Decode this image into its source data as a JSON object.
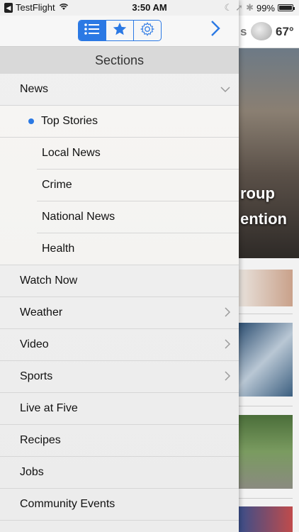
{
  "status_bar": {
    "back_app": "TestFlight",
    "time": "3:50 AM",
    "battery": "99%"
  },
  "toolbar": {
    "segments": [
      {
        "name": "sections",
        "icon": "list-icon",
        "active": true
      },
      {
        "name": "favorites",
        "icon": "star-icon",
        "active": false
      },
      {
        "name": "settings",
        "icon": "gear-icon",
        "active": false
      }
    ],
    "next_icon": "chevron-right-icon"
  },
  "drawer": {
    "title": "Sections",
    "items": [
      {
        "label": "News",
        "type": "top",
        "chevron": "down"
      },
      {
        "label": "Top Stories",
        "type": "sub",
        "selected": true
      },
      {
        "label": "Local News",
        "type": "sub"
      },
      {
        "label": "Crime",
        "type": "sub"
      },
      {
        "label": "National News",
        "type": "sub"
      },
      {
        "label": "Health",
        "type": "sub"
      },
      {
        "label": "Watch Now",
        "type": "top"
      },
      {
        "label": "Weather",
        "type": "top",
        "chevron": "right"
      },
      {
        "label": "Video",
        "type": "top",
        "chevron": "right"
      },
      {
        "label": "Sports",
        "type": "top",
        "chevron": "right"
      },
      {
        "label": "Live at Five",
        "type": "top"
      },
      {
        "label": "Recipes",
        "type": "top"
      },
      {
        "label": "Jobs",
        "type": "top"
      },
      {
        "label": "Community Events",
        "type": "top"
      }
    ]
  },
  "background_app": {
    "header_fragment": "s",
    "temperature": "67°",
    "hero_text_lines": [
      "roup",
      "ention"
    ]
  },
  "colors": {
    "accent": "#2b79e4"
  }
}
